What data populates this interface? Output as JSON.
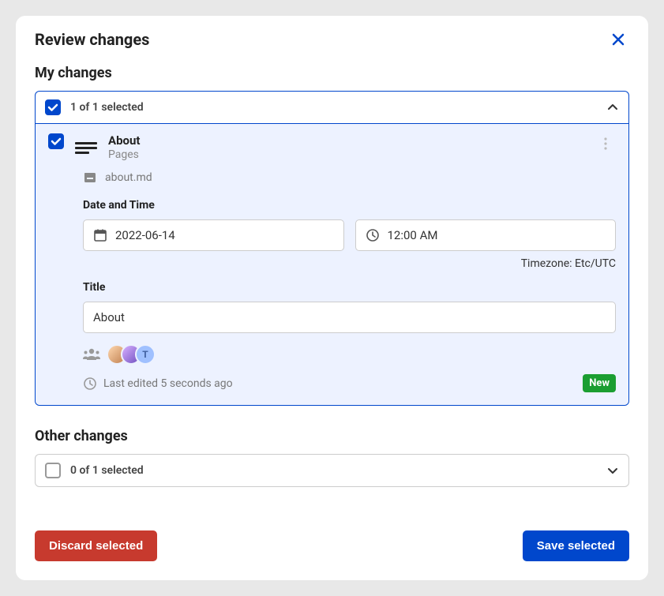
{
  "modal": {
    "title": "Review changes"
  },
  "sections": {
    "my_changes": "My changes",
    "other_changes": "Other changes"
  },
  "my_group": {
    "selected_text": "1 of 1 selected",
    "item": {
      "title": "About",
      "subtitle": "Pages",
      "filename": "about.md",
      "datetime_label": "Date and Time",
      "date": "2022-06-14",
      "time": "12:00 AM",
      "timezone": "Timezone: Etc/UTC",
      "title_label": "Title",
      "title_value": "About",
      "avatar_letter": "T",
      "last_edited": "Last edited 5 seconds ago",
      "badge": "New"
    }
  },
  "other_group": {
    "selected_text": "0 of 1 selected"
  },
  "buttons": {
    "discard": "Discard selected",
    "save": "Save selected"
  }
}
